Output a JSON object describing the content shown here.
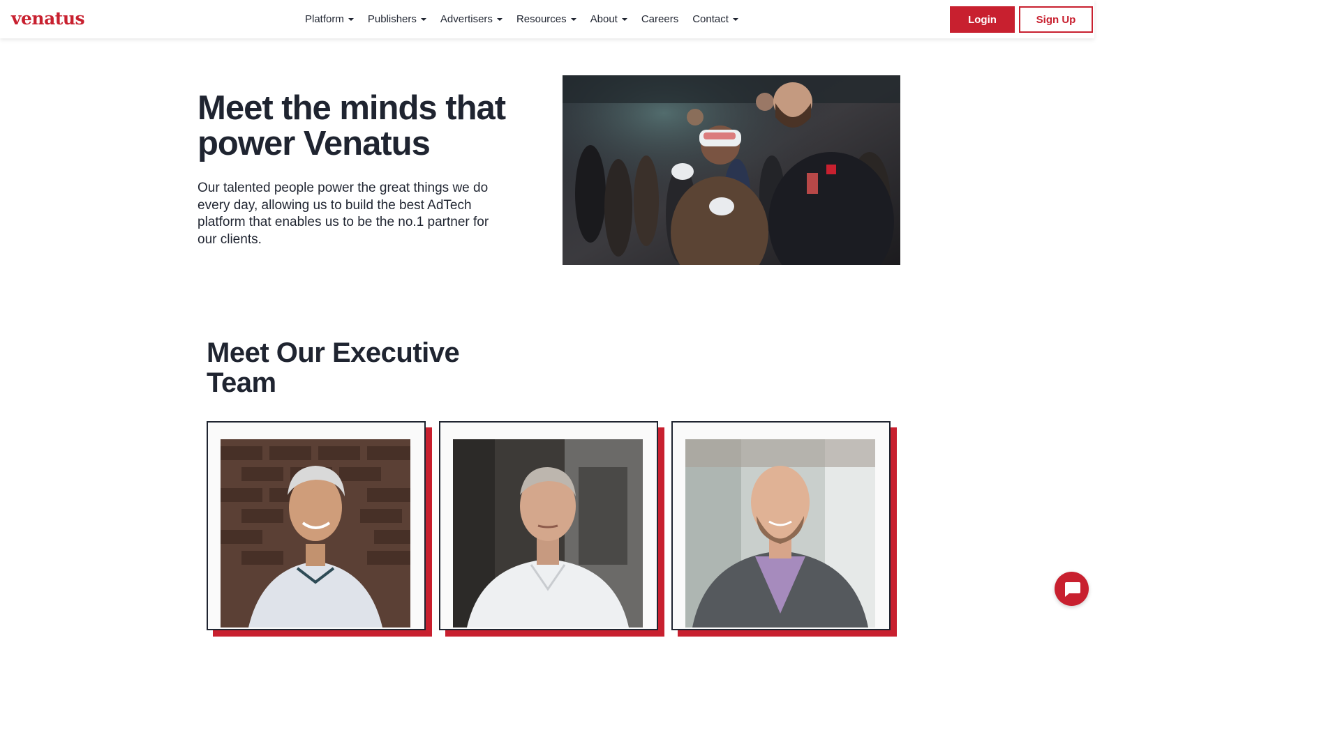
{
  "brand": {
    "logo_text": "venatus",
    "accent": "#c8202f",
    "text_color": "#1f2430"
  },
  "nav": {
    "items": [
      {
        "label": "Platform",
        "has_dropdown": true
      },
      {
        "label": "Publishers",
        "has_dropdown": true
      },
      {
        "label": "Advertisers",
        "has_dropdown": true
      },
      {
        "label": "Resources",
        "has_dropdown": true
      },
      {
        "label": "About",
        "has_dropdown": true
      },
      {
        "label": "Careers",
        "has_dropdown": false
      },
      {
        "label": "Contact",
        "has_dropdown": true
      }
    ],
    "login_label": "Login",
    "signup_label": "Sign Up"
  },
  "hero": {
    "title": "Meet the minds that power Venatus",
    "body": "Our talented people power the great things we do every day, allowing us to build the best AdTech platform that enables us to be the no.1 partner for our clients.",
    "photo_icon": "team-event-photo"
  },
  "team": {
    "title": "Meet Our Executive Team",
    "members": [
      {
        "photo_icon": "executive-portrait-1"
      },
      {
        "photo_icon": "executive-portrait-2"
      },
      {
        "photo_icon": "executive-portrait-3"
      }
    ]
  },
  "chat": {
    "icon": "chat-bubble-icon"
  }
}
